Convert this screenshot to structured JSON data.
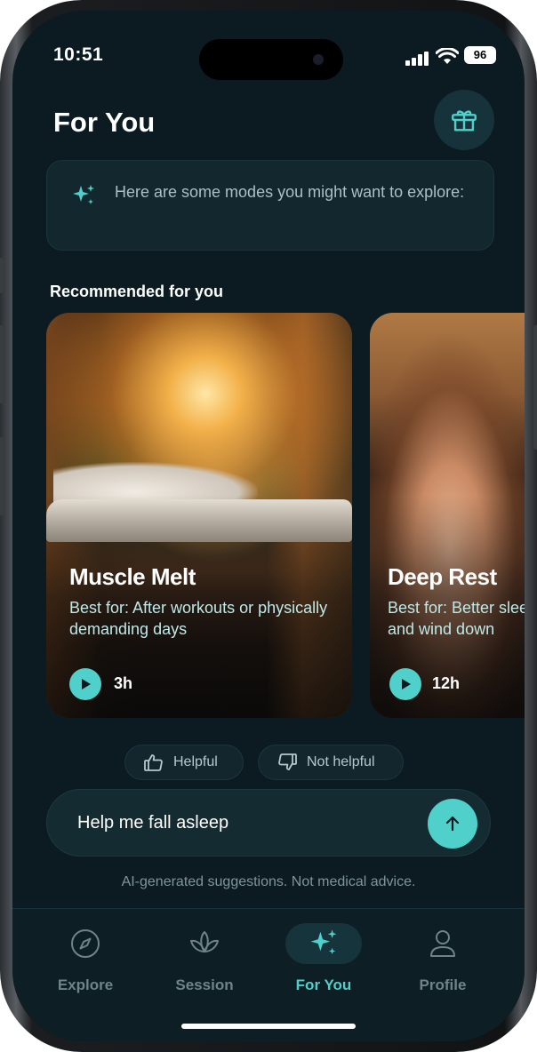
{
  "status": {
    "time": "10:51",
    "battery": "96"
  },
  "header": {
    "title": "For You"
  },
  "prompt": {
    "text": "Here are some modes you might want to explore:"
  },
  "recommended": {
    "heading": "Recommended for you",
    "cards": [
      {
        "title": "Muscle Melt",
        "desc": "Best for: After workouts or physically demanding days",
        "duration": "3h"
      },
      {
        "title": "Deep Rest",
        "desc": "Best for: Better sleep and wind down",
        "duration": "12h"
      }
    ]
  },
  "feedback": {
    "helpful": "Helpful",
    "not_helpful": "Not helpful"
  },
  "chat": {
    "input_value": "Help me fall asleep"
  },
  "disclaimer": "AI-generated suggestions. Not medical advice.",
  "tabs": [
    {
      "label": "Explore",
      "icon": "compass-icon"
    },
    {
      "label": "Session",
      "icon": "lotus-icon"
    },
    {
      "label": "For You",
      "icon": "sparkles-icon",
      "active": true
    },
    {
      "label": "Profile",
      "icon": "person-icon"
    }
  ],
  "colors": {
    "accent": "#4fd0cb",
    "background": "#0b1b21",
    "card": "#12272e"
  }
}
